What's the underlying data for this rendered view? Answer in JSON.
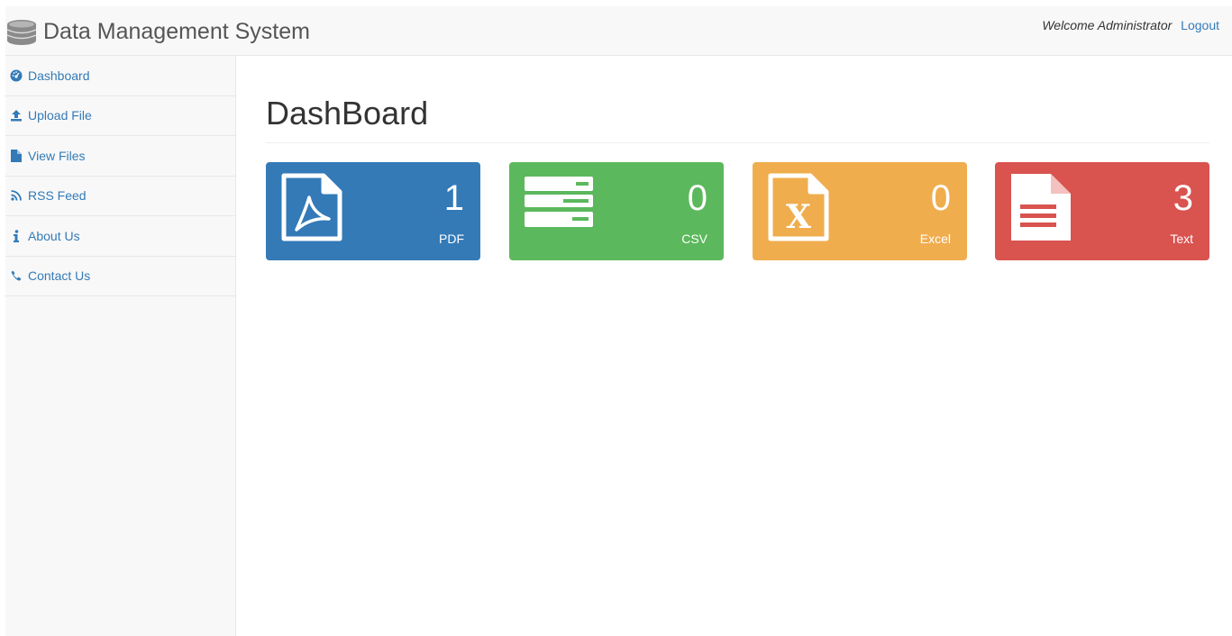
{
  "header": {
    "title": "Data Management System",
    "welcome": "Welcome Administrator",
    "logout": "Logout"
  },
  "sidebar": {
    "items": [
      {
        "label": "Dashboard",
        "icon": "dashboard-icon"
      },
      {
        "label": "Upload File",
        "icon": "upload-icon"
      },
      {
        "label": "View Files",
        "icon": "file-icon"
      },
      {
        "label": "RSS Feed",
        "icon": "rss-icon"
      },
      {
        "label": "About Us",
        "icon": "info-icon"
      },
      {
        "label": "Contact Us",
        "icon": "phone-icon"
      }
    ]
  },
  "main": {
    "title": "DashBoard",
    "cards": [
      {
        "count": "1",
        "label": "PDF",
        "icon": "pdf-file-icon",
        "color": "#337ab7"
      },
      {
        "count": "0",
        "label": "CSV",
        "icon": "csv-icon",
        "color": "#5cb85c"
      },
      {
        "count": "0",
        "label": "Excel",
        "icon": "excel-file-icon",
        "color": "#f0ad4e"
      },
      {
        "count": "3",
        "label": "Text",
        "icon": "text-file-icon",
        "color": "#d9534f"
      }
    ]
  },
  "colors": {
    "link": "#337ab7",
    "navbar_bg": "#f8f8f8"
  }
}
